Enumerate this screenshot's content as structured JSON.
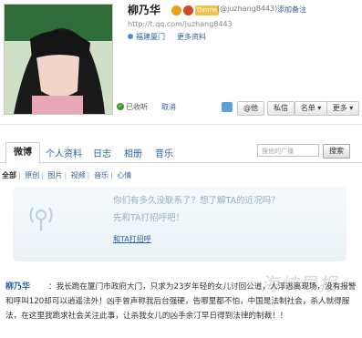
{
  "profile": {
    "name": "柳乃华",
    "level_badge": "Qzone",
    "handle": "(@juzhang8443)",
    "add_note": "添加备注",
    "url": "http://t.qq.com/juzhang8443",
    "location": "福建厦门",
    "more_info": "更多资料"
  },
  "follow": {
    "followed_label": "已收听",
    "cancel_label": "取消"
  },
  "actions": {
    "at_label": "@他",
    "private_msg_label": "私信",
    "list_label": "名单 ▾",
    "more_label": "更多 ▾"
  },
  "tabs": [
    {
      "label": "微博"
    },
    {
      "label": "个人资料"
    },
    {
      "label": "日志"
    },
    {
      "label": "相册"
    },
    {
      "label": "音乐"
    }
  ],
  "search": {
    "placeholder": "搜他的广播",
    "button": "搜索"
  },
  "filters": [
    {
      "label": "全部"
    },
    {
      "label": "原创"
    },
    {
      "label": "图片"
    },
    {
      "label": "视频"
    },
    {
      "label": "音乐"
    },
    {
      "label": "心情"
    }
  ],
  "empty_state": {
    "line1": "你们有多久没联系了？想了解TA的近况吗？",
    "line2": "先和TA打招呼吧！",
    "link": "和TA打招呼"
  },
  "post": {
    "author": "柳乃华",
    "text": "：我长跪在厦门市政府大门，只求为23岁年轻的女儿讨回公道，人浮逃离现场，没有报警和呼叫120却可以逍遥法外！凶手曾声称我后台强硬，告哪里都不怕，中国是法制社会，杀人就得服法，在这里我跪求社会关注此事，让杀我女儿的凶手余汀早日得到法律的制裁！！"
  },
  "watermark": "海峡导报",
  "colors": {
    "link": "#2a5f9e",
    "muted": "#8fb0c4"
  }
}
